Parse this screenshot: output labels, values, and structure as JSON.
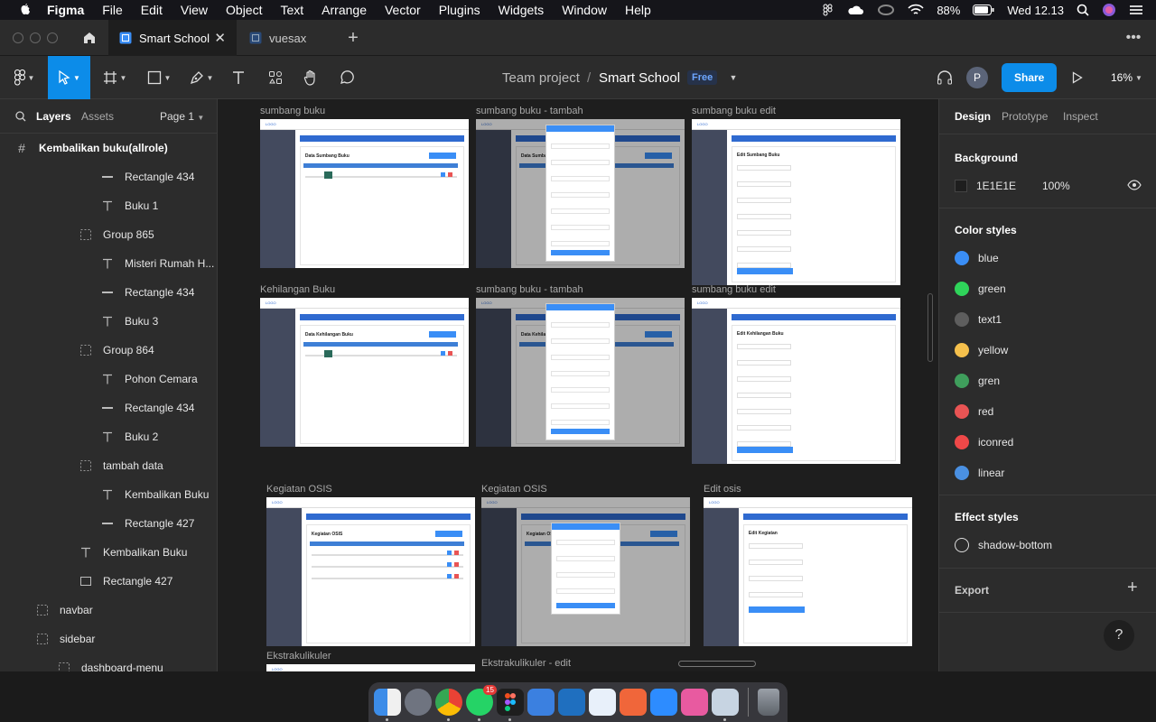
{
  "menubar": {
    "app": "Figma",
    "items": [
      "File",
      "Edit",
      "View",
      "Object",
      "Text",
      "Arrange",
      "Vector",
      "Plugins",
      "Widgets",
      "Window",
      "Help"
    ],
    "battery": "88%",
    "clock": "Wed 12.13"
  },
  "tabs": [
    {
      "label": "Smart School",
      "active": true
    },
    {
      "label": "vuesax",
      "active": false
    }
  ],
  "toolbar": {
    "project": "Team project",
    "separator": "/",
    "file": "Smart School",
    "badge": "Free",
    "avatar": "P",
    "share": "Share",
    "zoom": "16%"
  },
  "left": {
    "tab_layers": "Layers",
    "tab_assets": "Assets",
    "page": "Page 1",
    "frame": "Kembalikan buku(allrole)",
    "layers": [
      {
        "label": "Rectangle 434",
        "icon": "rect"
      },
      {
        "label": "Buku 1",
        "icon": "text"
      },
      {
        "label": "Group 865",
        "icon": "group"
      },
      {
        "label": "Misteri Rumah H...",
        "icon": "text"
      },
      {
        "label": "Rectangle 434",
        "icon": "rect"
      },
      {
        "label": "Buku 3",
        "icon": "text"
      },
      {
        "label": "Group 864",
        "icon": "group"
      },
      {
        "label": "Pohon Cemara",
        "icon": "text"
      },
      {
        "label": "Rectangle 434",
        "icon": "rect"
      },
      {
        "label": "Buku 2",
        "icon": "text"
      },
      {
        "label": "tambah data",
        "icon": "group"
      },
      {
        "label": "Kembalikan Buku",
        "icon": "text"
      },
      {
        "label": "Rectangle 427",
        "icon": "rect"
      },
      {
        "label": "Kembalikan Buku",
        "icon": "text"
      },
      {
        "label": "Rectangle 427",
        "icon": "box"
      },
      {
        "label": "navbar",
        "icon": "group"
      },
      {
        "label": "sidebar",
        "icon": "group"
      },
      {
        "label": "dashboard-menu",
        "icon": "group"
      }
    ]
  },
  "canvas": {
    "frames": [
      {
        "label": "sumbang buku",
        "title": "Data Sumbang Buku"
      },
      {
        "label": "sumbang buku - tambah",
        "title": "Data Sumbang"
      },
      {
        "label": "sumbang buku edit",
        "title": "Edit Sumbang Buku"
      },
      {
        "label": "Kehilangan Buku",
        "title": "Data Kehilangan Buku"
      },
      {
        "label": "sumbang buku - tambah",
        "title": "Data Kehilang"
      },
      {
        "label": "sumbang buku edit",
        "title": "Edit Kehilangan Buku"
      },
      {
        "label": "Kegiatan OSIS",
        "title": "Kegiatan OSIS"
      },
      {
        "label": "Kegiatan OSIS",
        "title": "Kegiatan OSIS"
      },
      {
        "label": "Edit osis",
        "title": "Edit Kegiatan"
      },
      {
        "label": "Ekstrakulikuler",
        "title": ""
      },
      {
        "label": "Ekstrakulikuler - edit",
        "title": ""
      }
    ],
    "logo": "LOGO"
  },
  "right": {
    "tabs": [
      "Design",
      "Prototype",
      "Inspect"
    ],
    "background_title": "Background",
    "background_hex": "1E1E1E",
    "background_opacity": "100%",
    "color_styles_title": "Color styles",
    "color_styles": [
      {
        "name": "blue",
        "color": "#3a8ef6"
      },
      {
        "name": "green",
        "color": "#2fd45a"
      },
      {
        "name": "text1",
        "color": "#5e5e5e"
      },
      {
        "name": "yellow",
        "color": "#f5c04c"
      },
      {
        "name": "gren",
        "color": "#3f9e5c"
      },
      {
        "name": "red",
        "color": "#e95454"
      },
      {
        "name": "iconred",
        "color": "#ef4848"
      },
      {
        "name": "linear",
        "color": "#4a90e2"
      }
    ],
    "effect_styles_title": "Effect styles",
    "effect_style": "shadow-bottom",
    "export_title": "Export",
    "help": "?"
  },
  "dock": {
    "badge": "15",
    "apps": [
      "finder-icon",
      "launchpad-icon",
      "chrome-icon",
      "whatsapp-icon",
      "figma-icon",
      "xcode-icon",
      "vscode-icon",
      "android-studio-icon",
      "pen-icon",
      "zoom-icon",
      "onyx-icon",
      "preview-icon",
      "trash-icon"
    ]
  }
}
